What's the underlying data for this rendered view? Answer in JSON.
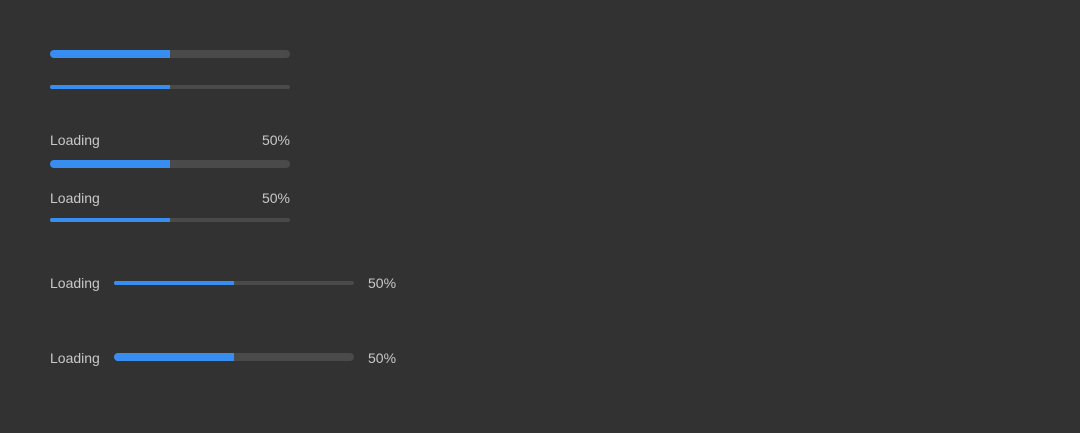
{
  "colors": {
    "background": "#323232",
    "track": "#4a4a4a",
    "fill": "#378ef0",
    "text": "#c8c8c8"
  },
  "progress_bars": [
    {
      "label": "",
      "value_text": "",
      "progress": 0.5,
      "size": "large",
      "label_position": "none"
    },
    {
      "label": "",
      "value_text": "",
      "progress": 0.5,
      "size": "small",
      "label_position": "none"
    },
    {
      "label": "Loading",
      "value_text": "50%",
      "progress": 0.5,
      "size": "large",
      "label_position": "top"
    },
    {
      "label": "Loading",
      "value_text": "50%",
      "progress": 0.5,
      "size": "small",
      "label_position": "top"
    },
    {
      "label": "Loading",
      "value_text": "50%",
      "progress": 0.5,
      "size": "small",
      "label_position": "side"
    },
    {
      "label": "Loading",
      "value_text": "50%",
      "progress": 0.5,
      "size": "large",
      "label_position": "side"
    }
  ]
}
